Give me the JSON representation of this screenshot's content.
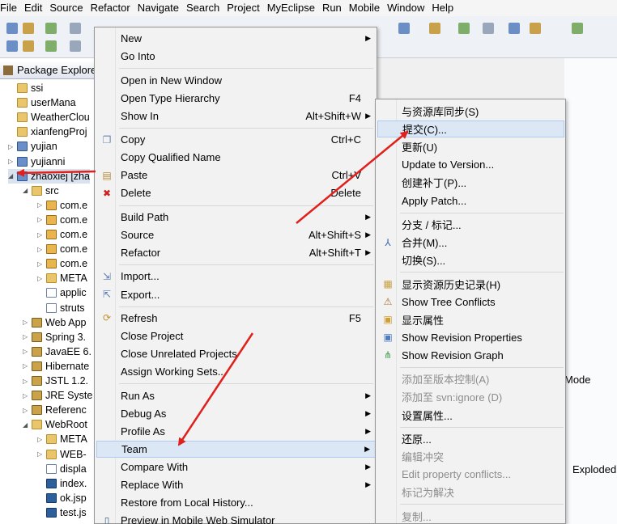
{
  "menubar": [
    "File",
    "Edit",
    "Source",
    "Refactor",
    "Navigate",
    "Search",
    "Project",
    "MyEclipse",
    "Run",
    "Mobile",
    "Window",
    "Help"
  ],
  "explorer": {
    "tab_title": "Package Explore",
    "items": [
      {
        "label": "ssi",
        "icon": "folder",
        "indent": 0,
        "twisty": ""
      },
      {
        "label": "userMana",
        "icon": "folder",
        "indent": 0,
        "twisty": ""
      },
      {
        "label": "WeatherClou",
        "icon": "folder",
        "indent": 0,
        "twisty": ""
      },
      {
        "label": "xianfengProj",
        "icon": "folder",
        "indent": 0,
        "twisty": ""
      },
      {
        "label": "yujian",
        "icon": "proj",
        "indent": 0,
        "twisty": "▷"
      },
      {
        "label": "yujianni",
        "icon": "proj",
        "indent": 0,
        "twisty": "▷"
      },
      {
        "label": "zhaoxiej [zha",
        "icon": "proj",
        "indent": 0,
        "twisty": "◢"
      },
      {
        "label": "src",
        "icon": "folder",
        "indent": 1,
        "twisty": "◢"
      },
      {
        "label": "com.e",
        "icon": "pkg",
        "indent": 2,
        "twisty": "▷"
      },
      {
        "label": "com.e",
        "icon": "pkg",
        "indent": 2,
        "twisty": "▷"
      },
      {
        "label": "com.e",
        "icon": "pkg",
        "indent": 2,
        "twisty": "▷"
      },
      {
        "label": "com.e",
        "icon": "pkg",
        "indent": 2,
        "twisty": "▷"
      },
      {
        "label": "com.e",
        "icon": "pkg",
        "indent": 2,
        "twisty": "▷"
      },
      {
        "label": "META",
        "icon": "folder",
        "indent": 2,
        "twisty": "▷"
      },
      {
        "label": "applic",
        "icon": "file",
        "indent": 2,
        "twisty": ""
      },
      {
        "label": "struts",
        "icon": "file",
        "indent": 2,
        "twisty": ""
      },
      {
        "label": "Web App",
        "icon": "lib",
        "indent": 1,
        "twisty": "▷"
      },
      {
        "label": "Spring 3.",
        "icon": "lib",
        "indent": 1,
        "twisty": "▷"
      },
      {
        "label": "JavaEE 6.",
        "icon": "lib",
        "indent": 1,
        "twisty": "▷"
      },
      {
        "label": "Hibernate",
        "icon": "lib",
        "indent": 1,
        "twisty": "▷"
      },
      {
        "label": "JSTL 1.2.",
        "icon": "lib",
        "indent": 1,
        "twisty": "▷"
      },
      {
        "label": "JRE Syste",
        "icon": "lib",
        "indent": 1,
        "twisty": "▷"
      },
      {
        "label": "Referenc",
        "icon": "lib",
        "indent": 1,
        "twisty": "▷"
      },
      {
        "label": "WebRoot",
        "icon": "folder",
        "indent": 1,
        "twisty": "◢"
      },
      {
        "label": "META",
        "icon": "folder",
        "indent": 2,
        "twisty": "▷"
      },
      {
        "label": "WEB-",
        "icon": "folder",
        "indent": 2,
        "twisty": "▷"
      },
      {
        "label": "displa",
        "icon": "file",
        "indent": 2,
        "twisty": ""
      },
      {
        "label": "index.",
        "icon": "java",
        "indent": 2,
        "twisty": ""
      },
      {
        "label": "ok.jsp",
        "icon": "java",
        "indent": 2,
        "twisty": ""
      },
      {
        "label": "test.js",
        "icon": "java",
        "indent": 2,
        "twisty": ""
      }
    ]
  },
  "right_pane": {
    "mode_label": "Mode",
    "exploded_label": "Exploded"
  },
  "context_menu": {
    "items": [
      {
        "label": "New",
        "shortcut": "",
        "submenu": true
      },
      {
        "label": "Go Into",
        "shortcut": ""
      },
      {
        "sep": true
      },
      {
        "label": "Open in New Window",
        "shortcut": ""
      },
      {
        "label": "Open Type Hierarchy",
        "shortcut": "F4"
      },
      {
        "label": "Show In",
        "shortcut": "Alt+Shift+W",
        "submenu": true
      },
      {
        "sep": true
      },
      {
        "label": "Copy",
        "shortcut": "Ctrl+C",
        "icon": "copy-icon"
      },
      {
        "label": "Copy Qualified Name",
        "shortcut": "",
        "icon": "copy-qualified-icon"
      },
      {
        "label": "Paste",
        "shortcut": "Ctrl+V",
        "icon": "paste-icon"
      },
      {
        "label": "Delete",
        "shortcut": "Delete",
        "icon": "delete-icon"
      },
      {
        "sep": true
      },
      {
        "label": "Build Path",
        "shortcut": "",
        "submenu": true
      },
      {
        "label": "Source",
        "shortcut": "Alt+Shift+S",
        "submenu": true
      },
      {
        "label": "Refactor",
        "shortcut": "Alt+Shift+T",
        "submenu": true
      },
      {
        "sep": true
      },
      {
        "label": "Import...",
        "shortcut": "",
        "icon": "import-icon"
      },
      {
        "label": "Export...",
        "shortcut": "",
        "icon": "export-icon"
      },
      {
        "sep": true
      },
      {
        "label": "Refresh",
        "shortcut": "F5",
        "icon": "refresh-icon"
      },
      {
        "label": "Close Project",
        "shortcut": ""
      },
      {
        "label": "Close Unrelated Projects",
        "shortcut": ""
      },
      {
        "label": "Assign Working Sets...",
        "shortcut": ""
      },
      {
        "sep": true
      },
      {
        "label": "Run As",
        "shortcut": "",
        "submenu": true
      },
      {
        "label": "Debug As",
        "shortcut": "",
        "submenu": true
      },
      {
        "label": "Profile As",
        "shortcut": "",
        "submenu": true
      },
      {
        "label": "Team",
        "shortcut": "",
        "submenu": true,
        "highlight": true
      },
      {
        "label": "Compare With",
        "shortcut": "",
        "submenu": true
      },
      {
        "label": "Replace With",
        "shortcut": "",
        "submenu": true
      },
      {
        "label": "Restore from Local History...",
        "shortcut": ""
      },
      {
        "label": "Preview in Mobile Web Simulator",
        "shortcut": "",
        "icon": "mobile-icon"
      }
    ]
  },
  "team_submenu": {
    "items": [
      {
        "label": "与资源库同步(S)"
      },
      {
        "label": "提交(C)...",
        "highlight": true
      },
      {
        "label": "更新(U)"
      },
      {
        "label": "Update to Version..."
      },
      {
        "label": "创建补丁(P)..."
      },
      {
        "label": "Apply Patch..."
      },
      {
        "sep": true
      },
      {
        "label": "分支 / 标记..."
      },
      {
        "label": "合并(M)...",
        "icon": "merge-icon"
      },
      {
        "label": "切换(S)..."
      },
      {
        "sep": true
      },
      {
        "label": "显示资源历史记录(H)",
        "icon": "history-icon"
      },
      {
        "label": "Show Tree Conflicts",
        "icon": "tree-conflicts-icon"
      },
      {
        "label": "显示属性",
        "icon": "properties-icon"
      },
      {
        "label": "Show Revision Properties",
        "icon": "revision-properties-icon"
      },
      {
        "label": "Show Revision Graph",
        "icon": "revision-graph-icon"
      },
      {
        "sep": true
      },
      {
        "label": "添加至版本控制(A)",
        "disabled": true
      },
      {
        "label": "添加至 svn:ignore (D)",
        "disabled": true
      },
      {
        "label": "设置属性..."
      },
      {
        "sep": true
      },
      {
        "label": "还原..."
      },
      {
        "label": "编辑冲突",
        "disabled": true
      },
      {
        "label": "Edit property conflicts...",
        "disabled": true
      },
      {
        "label": "标记为解决",
        "disabled": true
      },
      {
        "sep": true
      },
      {
        "label": "复制...",
        "disabled": true
      }
    ]
  },
  "colors": {
    "highlight": "#dce7f6",
    "arrow": "#e0201c"
  }
}
